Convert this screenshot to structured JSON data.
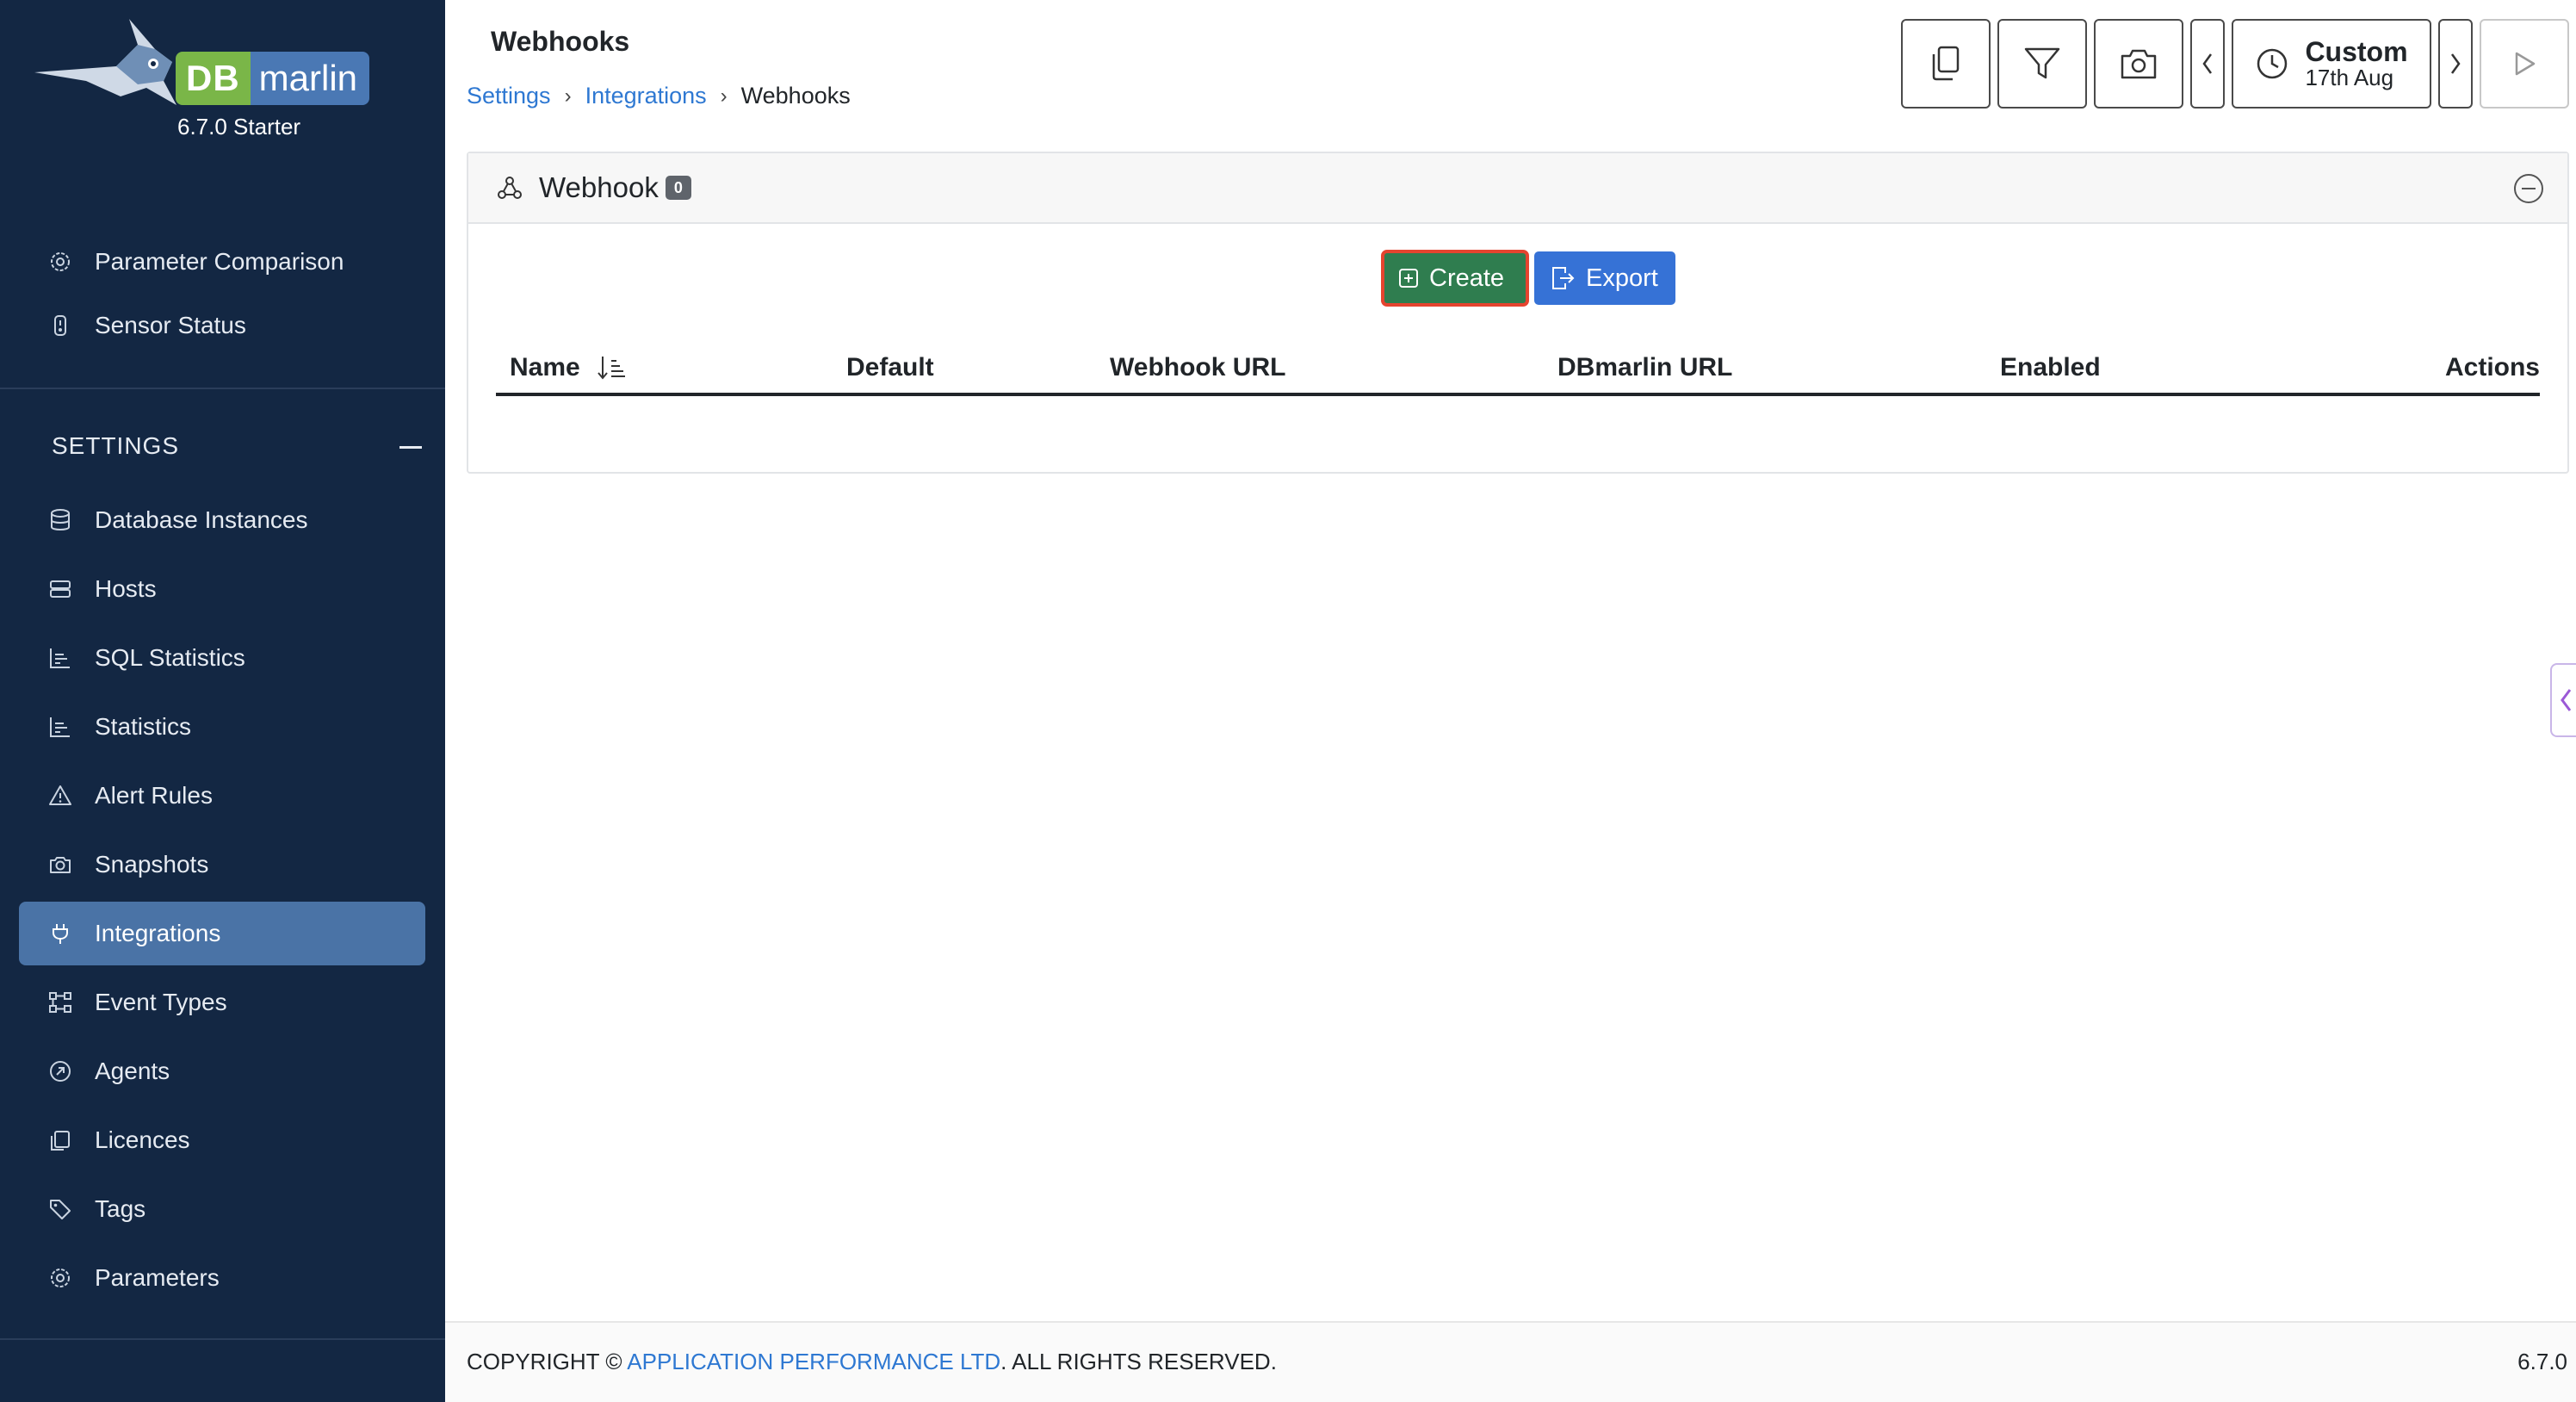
{
  "app": {
    "logo_db": "DB",
    "logo_marlin": "marlin",
    "version_label": "6.7.0 Starter"
  },
  "sidebar": {
    "top_items": [
      {
        "label": "Parameter Comparison",
        "icon": "gear-icon"
      },
      {
        "label": "Sensor Status",
        "icon": "sensor-icon"
      }
    ],
    "settings_heading": "SETTINGS",
    "items": [
      {
        "label": "Database Instances",
        "icon": "database-icon"
      },
      {
        "label": "Hosts",
        "icon": "server-icon"
      },
      {
        "label": "SQL Statistics",
        "icon": "bar-chart-icon"
      },
      {
        "label": "Statistics",
        "icon": "bar-chart-icon"
      },
      {
        "label": "Alert Rules",
        "icon": "warning-icon"
      },
      {
        "label": "Snapshots",
        "icon": "camera-icon"
      },
      {
        "label": "Integrations",
        "icon": "plug-icon",
        "active": true
      },
      {
        "label": "Event Types",
        "icon": "diagram-icon"
      },
      {
        "label": "Agents",
        "icon": "agent-icon"
      },
      {
        "label": "Licences",
        "icon": "licence-icon"
      },
      {
        "label": "Tags",
        "icon": "tags-icon"
      },
      {
        "label": "Parameters",
        "icon": "gear-icon"
      }
    ]
  },
  "header": {
    "title": "Webhooks",
    "breadcrumb": [
      "Settings",
      "Integrations",
      "Webhooks"
    ]
  },
  "toolbar": {
    "time_range_label": "Custom",
    "time_range_date": "17th Aug",
    "icons": [
      "copy-icon",
      "filter-icon",
      "camera-icon",
      "chevron-left-icon",
      "clock-icon",
      "chevron-right-icon",
      "play-icon"
    ]
  },
  "panel": {
    "title": "Webhook",
    "count": "0",
    "create_label": "Create",
    "export_label": "Export",
    "columns": [
      "Name",
      "Default",
      "Webhook URL",
      "DBmarlin URL",
      "Enabled",
      "Actions"
    ],
    "rows": []
  },
  "footer": {
    "prefix": "COPYRIGHT © ",
    "company": "APPLICATION PERFORMANCE LTD",
    "suffix": ". ALL RIGHTS RESERVED.",
    "version": "6.7.0"
  },
  "colors": {
    "sidebar_bg": "#132743",
    "active_item": "#4a73a6",
    "create_button": "#2f7d4f",
    "export_button": "#3672d6",
    "link": "#2e78d2"
  }
}
